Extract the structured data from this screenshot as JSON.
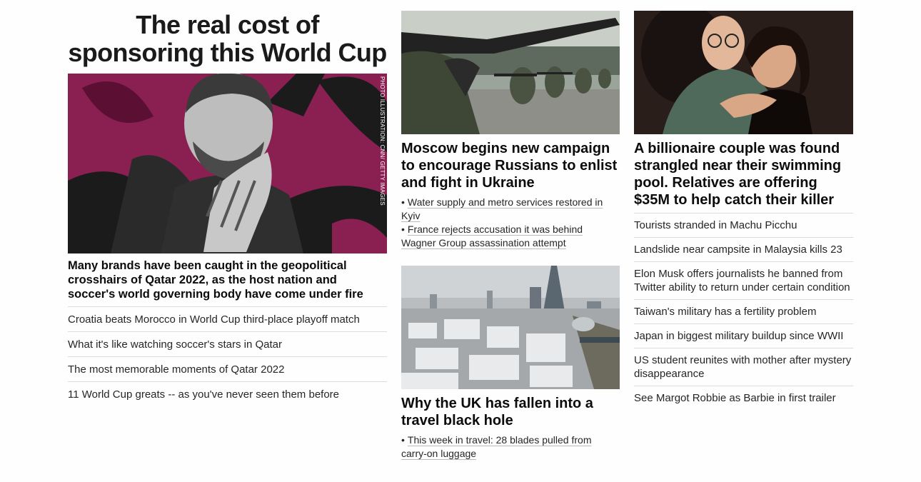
{
  "hero": {
    "title": "The real cost of sponsoring this World Cup",
    "image_credit": "PHOTO ILLUSTRATION: CNN/ GETTY IMAGES",
    "caption": "Many brands have been caught in the geopolitical crosshairs of Qatar 2022, as the host nation and soccer's world governing body have come under fire",
    "links": [
      "Croatia beats Morocco in World Cup third-place playoff match",
      "What it's like watching soccer's stars in Qatar",
      "The most memorable moments of Qatar 2022",
      "11 World Cup greats -- as you've never seen them before"
    ]
  },
  "middle": {
    "stories": [
      {
        "headline": "Moscow begins new campaign to encourage Russians to enlist and fight in Ukraine",
        "bullets": [
          "Water supply and metro services restored in Kyiv",
          "France rejects accusation it was behind Wagner Group assassination attempt"
        ]
      },
      {
        "headline": "Why the UK has fallen into a travel black hole",
        "bullets": [
          "This week in travel: 28 blades pulled from carry-on luggage"
        ]
      }
    ],
    "bullet_char": "•"
  },
  "right": {
    "headline": "A billionaire couple was found strangled near their swimming pool. Relatives are offering $35M to help catch their killer",
    "links": [
      "Tourists stranded in Machu Picchu",
      "Landslide near campsite in Malaysia kills 23",
      "Elon Musk offers journalists he banned from Twitter ability to return under certain condition",
      "Taiwan's military has a fertility problem",
      "Japan in biggest military buildup since WWII",
      "US student reunites with mother after mystery disappearance",
      "See Margot Robbie as Barbie in first trailer"
    ]
  }
}
